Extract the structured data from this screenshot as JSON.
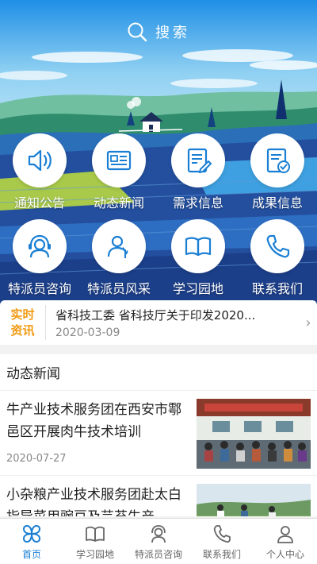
{
  "search": {
    "label": "搜索"
  },
  "menu": {
    "row1": [
      {
        "label": "通知公告",
        "icon": "speaker-icon"
      },
      {
        "label": "动态新闻",
        "icon": "news-icon"
      },
      {
        "label": "需求信息",
        "icon": "edit-document-icon"
      },
      {
        "label": "成果信息",
        "icon": "certified-document-icon"
      }
    ],
    "row2": [
      {
        "label": "特派员咨询",
        "icon": "headset-icon"
      },
      {
        "label": "特派员风采",
        "icon": "person-leaf-icon"
      },
      {
        "label": "学习园地",
        "icon": "book-icon"
      },
      {
        "label": "联系我们",
        "icon": "phone-icon"
      }
    ]
  },
  "ticker": {
    "badge_line1": "实时",
    "badge_line2": "资讯",
    "title": "省科技工委 省科技厅关于印发2020...",
    "date": "2020-03-09"
  },
  "news": {
    "heading": "动态新闻",
    "items": [
      {
        "title": "牛产业技术服务团在西安市鄠邑区开展肉牛技术培训",
        "date": "2020-07-27"
      },
      {
        "title": "小杂粮产业技术服务团赴太白指导菜用豌豆及芸苔生产",
        "date": ""
      }
    ]
  },
  "tabs": [
    {
      "label": "首页",
      "active": true
    },
    {
      "label": "学习园地",
      "active": false
    },
    {
      "label": "特派员咨询",
      "active": false
    },
    {
      "label": "联系我们",
      "active": false
    },
    {
      "label": "个人中心",
      "active": false
    }
  ],
  "colors": {
    "accent": "#1a7fd4",
    "badge": "#f29a12",
    "sky": "#3aa6e8"
  }
}
